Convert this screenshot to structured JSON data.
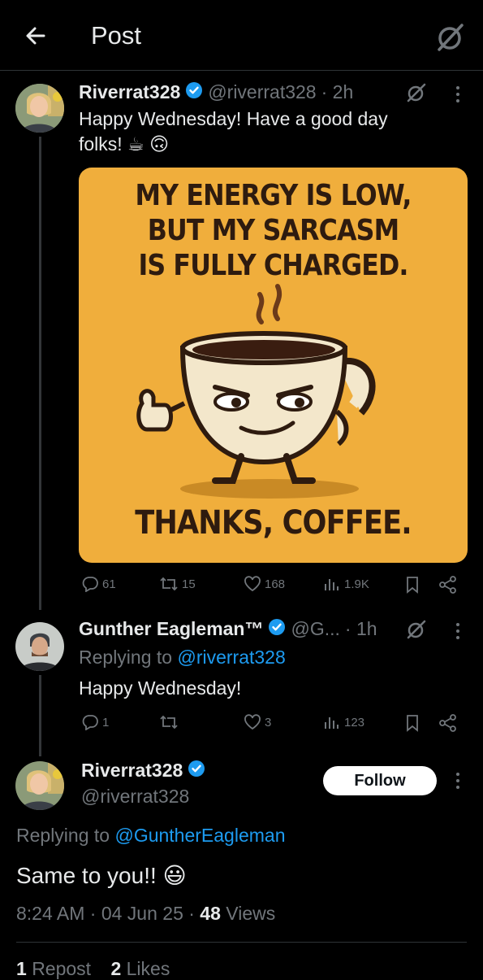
{
  "header": {
    "title": "Post"
  },
  "main_post": {
    "name": "Riverrat328",
    "handle": "@riverrat328",
    "time": "· 2h",
    "text_line1": "Happy Wednesday! Have a good day",
    "text_line2": "folks! ☕ 🙃",
    "meme": {
      "line1": "MY ENERGY IS LOW,",
      "line2": "BUT MY SARCASM",
      "line3": "IS FULLY CHARGED.",
      "line4": "THANKS, COFFEE."
    },
    "stats": {
      "replies": "61",
      "reposts": "15",
      "likes": "168",
      "views": "1.9K"
    }
  },
  "reply": {
    "name": "Gunther Eagleman™",
    "handle": "@G...",
    "time": "· 1h",
    "replying_label": "Replying to",
    "replying_to": "@riverrat328",
    "text": "Happy Wednesday!",
    "stats": {
      "replies": "1",
      "reposts": "",
      "likes": "3",
      "views": "123"
    }
  },
  "focused_post": {
    "name": "Riverrat328",
    "handle": "@riverrat328",
    "follow_label": "Follow",
    "replying_label": "Replying to",
    "replying_to": "@GuntherEagleman",
    "text": "Same to you!! 😃",
    "timestamp": "8:24 AM · 04 Jun 25 ·",
    "views_count": "48",
    "views_label": "Views",
    "reposts_count": "1",
    "reposts_label": "Repost",
    "likes_count": "2",
    "likes_label": "Likes"
  },
  "colors": {
    "accent": "#1d9bf0",
    "verified": "#1d9bf0",
    "meme_bg": "#f0ae3c"
  }
}
